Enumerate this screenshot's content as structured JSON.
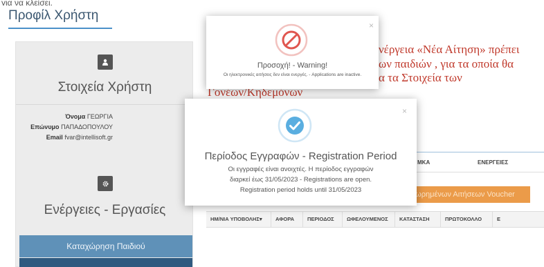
{
  "top_strip": "για να κλείσει.",
  "page_title": "Προφίλ Χρήστη",
  "user_details": {
    "heading": "Στοιχεία Χρήστη",
    "fields": [
      {
        "label": "Όνομα",
        "value": "ΓΕΩΡΓΙΑ"
      },
      {
        "label": "Επώνυμο",
        "value": "ΠΑΠΑΔΟΠΟΥΛΟΥ"
      },
      {
        "label": "Email",
        "value": "fvar@intellisoft.gr"
      }
    ]
  },
  "actions": {
    "heading": "Ενέργειες - Εργασίες",
    "register_child_button": "Καταχώρηση Παιδιού"
  },
  "notice": {
    "line1": "νέργεια «Νέα Αίτηση» πρέπει",
    "line2": "ων παιδιών , για τα οποία θα",
    "line3": "α τα Στοιχεία των",
    "line4": "Γονέων/Κηδεμόνων"
  },
  "children_table": {
    "headers": [
      "ΜΚΑ",
      "ΕΝΕΡΓΕΙΕΣ"
    ]
  },
  "voucher_button": "ωρημένων Αιτήσεων Voucher",
  "applications_table": {
    "headers": [
      "ΗΜ/ΝΙΑ ΥΠΟΒΟΛΗΣ▾",
      "ΑΦΟΡΑ",
      "ΠΕΡΙΟΔΟΣ",
      "ΩΦΕΛΟΥΜΕΝΟΣ",
      "ΚΑΤΑΣΤΑΣΗ",
      "ΠΡΩΤΟΚΟΛΛΟ",
      "Ε"
    ]
  },
  "warning_modal": {
    "title": "Προσοχή! - Warning!",
    "message": "Οι ηλεκτρονικές αιτήσεις δεν είναι ενεργές. - Applications are inactive.",
    "close": "×",
    "icon": "ban-icon",
    "color": "#e0564f"
  },
  "registration_modal": {
    "title": "Περίοδος Εγγραφών - Registration Period",
    "message": "Οι εγγραφές είναι ανοιχτές. Η περίοδος εγγραφών διαρκεί έως 31/05/2023 - Registrations are open. Registration period holds until 31/05/2023",
    "close": "×",
    "icon": "check-circle-icon",
    "color": "#5aaee0"
  }
}
